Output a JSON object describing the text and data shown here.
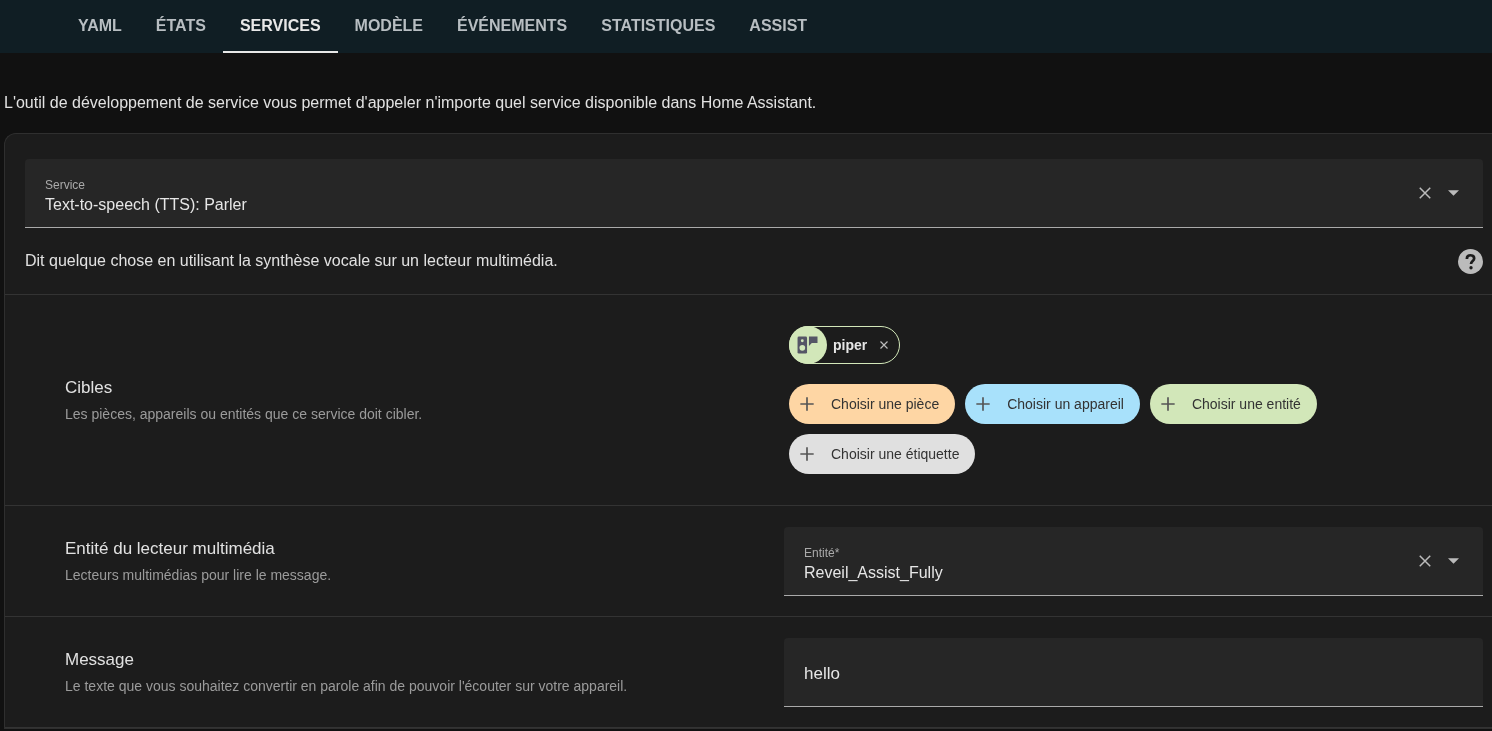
{
  "tabs": [
    {
      "label": "YAML",
      "selected": false
    },
    {
      "label": "ÉTATS",
      "selected": false
    },
    {
      "label": "SERVICES",
      "selected": true
    },
    {
      "label": "MODÈLE",
      "selected": false
    },
    {
      "label": "ÉVÉNEMENTS",
      "selected": false
    },
    {
      "label": "STATISTIQUES",
      "selected": false
    },
    {
      "label": "ASSIST",
      "selected": false
    }
  ],
  "intro": "L'outil de développement de service vous permet d'appeler n'importe quel service disponible dans Home Assistant.",
  "service": {
    "label": "Service",
    "value": "Text-to-speech (TTS): Parler"
  },
  "description": "Dit quelque chose en utilisant la synthèse vocale sur un lecteur multimédia.",
  "fields": [
    {
      "kind": "targets",
      "name": "Cibles",
      "hint": "Les pièces, appareils ou entités que ce service doit cibler.",
      "chips": [
        {
          "label": "piper"
        }
      ],
      "pickers": [
        {
          "label": "Choisir une pièce",
          "color": "#fed6a4"
        },
        {
          "label": "Choisir un appareil",
          "color": "#a8e1fb"
        },
        {
          "label": "Choisir une entité",
          "color": "#d2e7b9"
        },
        {
          "label": "Choisir une étiquette",
          "color": "#e0e0e0"
        }
      ]
    },
    {
      "kind": "entity",
      "name": "Entité du lecteur multimédia",
      "hint": "Lecteurs multimédias pour lire le message.",
      "label": "Entité*",
      "value": "Reveil_Assist_Fully"
    },
    {
      "kind": "text",
      "name": "Message",
      "hint": "Le texte que vous souhaitez convertir en parole afin de pouvoir l'écouter sur votre appareil.",
      "value": "hello"
    }
  ]
}
